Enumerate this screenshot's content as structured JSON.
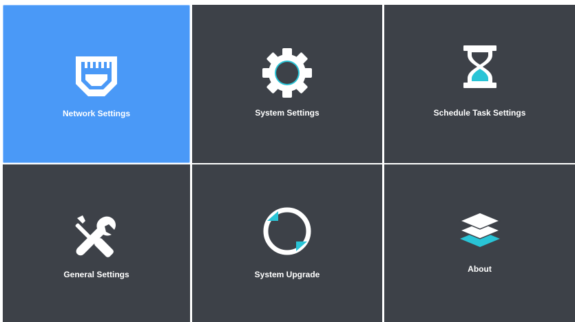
{
  "menu": {
    "tiles": [
      {
        "id": "network",
        "label": "Network Settings",
        "icon": "ethernet-port-icon",
        "selected": true
      },
      {
        "id": "system",
        "label": "System Settings",
        "icon": "gear-icon",
        "selected": false
      },
      {
        "id": "schedule",
        "label": "Schedule Task Settings",
        "icon": "hourglass-icon",
        "selected": false
      },
      {
        "id": "general",
        "label": "General Settings",
        "icon": "wrench-screwdriver-icon",
        "selected": false
      },
      {
        "id": "upgrade",
        "label": "System Upgrade",
        "icon": "refresh-circle-icon",
        "selected": false
      },
      {
        "id": "about",
        "label": "About",
        "icon": "layers-icon",
        "selected": false
      }
    ]
  },
  "colors": {
    "tile_bg": "#3d4148",
    "selected_bg": "#4a99f7",
    "accent": "#29c4d6",
    "text": "#ffffff"
  }
}
